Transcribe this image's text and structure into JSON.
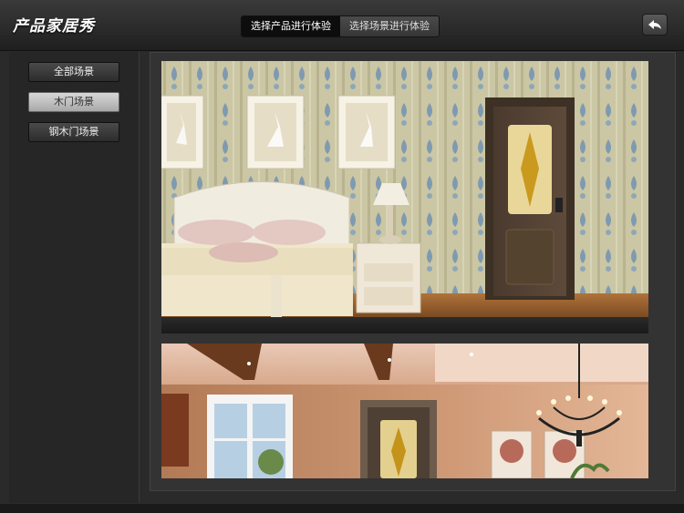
{
  "app": {
    "title": "产品家居秀"
  },
  "header": {
    "tabs": [
      {
        "label": "选择产品进行体验",
        "active": true
      },
      {
        "label": "选择场景进行体验",
        "active": false
      }
    ],
    "back_icon": "back-arrow-icon"
  },
  "sidebar": {
    "items": [
      {
        "label": "全部场景",
        "selected": false
      },
      {
        "label": "木门场景",
        "selected": true
      },
      {
        "label": "钢木门场景",
        "selected": false
      }
    ]
  },
  "scenes": [
    {
      "name": "bedroom-scene"
    },
    {
      "name": "living-room-scene"
    }
  ]
}
